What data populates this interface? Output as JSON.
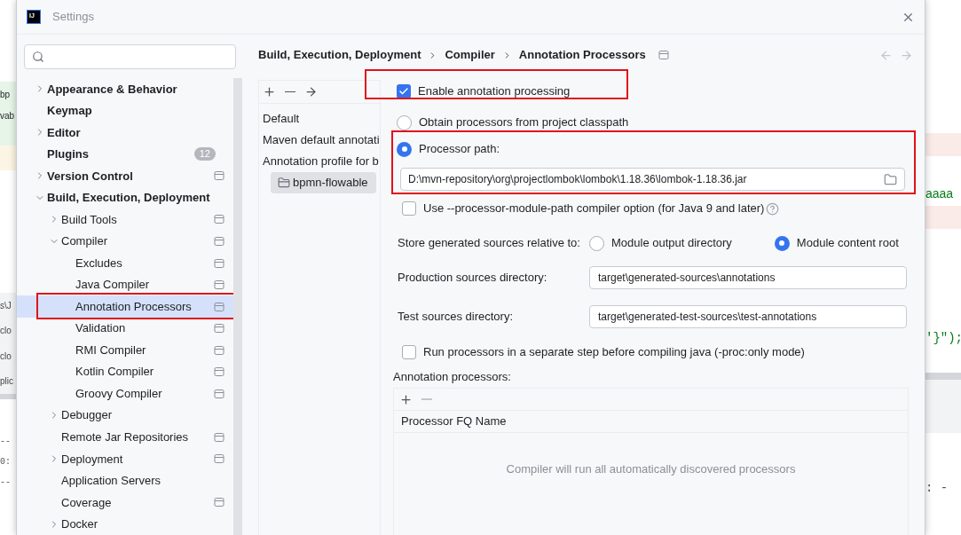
{
  "background": {
    "left_lines": [
      "bp",
      "vab",
      "s\\J",
      "clo",
      "clo",
      "plic",
      "--",
      "0:",
      "--"
    ],
    "right_lines": [
      "aaaa",
      "'}\");",
      ": -"
    ]
  },
  "window": {
    "logo": "IJ",
    "title": "Settings"
  },
  "sidebar": {
    "items": [
      {
        "label": "Appearance & Behavior",
        "expanded": false,
        "selected": false,
        "highlighted": false,
        "project_icon": false
      },
      {
        "label": "Keymap",
        "selected": false,
        "highlighted": false,
        "project_icon": false
      },
      {
        "label": "Editor",
        "expanded": false,
        "selected": false,
        "highlighted": false,
        "project_icon": false
      },
      {
        "label": "Plugins",
        "badge": "12",
        "selected": false,
        "highlighted": false,
        "project_icon": false
      },
      {
        "label": "Version Control",
        "expanded": false,
        "selected": false,
        "highlighted": false,
        "project_icon": true
      },
      {
        "label": "Build, Execution, Deployment",
        "expanded": true,
        "selected": false,
        "highlighted": false,
        "project_icon": false,
        "children": [
          {
            "label": "Build Tools",
            "expanded": false,
            "selected": false,
            "highlighted": false,
            "project_icon": true
          },
          {
            "label": "Compiler",
            "expanded": true,
            "selected": false,
            "highlighted": false,
            "project_icon": true,
            "children": [
              {
                "label": "Excludes",
                "selected": false,
                "highlighted": false,
                "project_icon": true
              },
              {
                "label": "Java Compiler",
                "selected": false,
                "highlighted": false,
                "project_icon": true
              },
              {
                "label": "Annotation Processors",
                "selected": true,
                "highlighted": true,
                "project_icon": true
              },
              {
                "label": "Validation",
                "selected": false,
                "highlighted": false,
                "project_icon": true
              },
              {
                "label": "RMI Compiler",
                "selected": false,
                "highlighted": false,
                "project_icon": true
              },
              {
                "label": "Kotlin Compiler",
                "selected": false,
                "highlighted": false,
                "project_icon": true
              },
              {
                "label": "Groovy Compiler",
                "selected": false,
                "highlighted": false,
                "project_icon": true
              }
            ]
          },
          {
            "label": "Debugger",
            "expanded": false,
            "selected": false,
            "highlighted": false,
            "project_icon": false
          },
          {
            "label": "Remote Jar Repositories",
            "selected": false,
            "highlighted": false,
            "project_icon": true
          },
          {
            "label": "Deployment",
            "expanded": false,
            "selected": false,
            "highlighted": false,
            "project_icon": true
          },
          {
            "label": "Application Servers",
            "selected": false,
            "highlighted": false,
            "project_icon": false
          },
          {
            "label": "Coverage",
            "selected": false,
            "highlighted": false,
            "project_icon": true
          },
          {
            "label": "Docker",
            "expanded": false,
            "selected": false,
            "highlighted": false,
            "project_icon": false
          }
        ]
      }
    ]
  },
  "breadcrumb": [
    "Build, Execution, Deployment",
    "Compiler",
    "Annotation Processors"
  ],
  "profiles": [
    {
      "label": "Default",
      "selected": false
    },
    {
      "label": "Maven default annotati",
      "selected": false
    },
    {
      "label": "Annotation profile for b",
      "selected": false,
      "children": [
        {
          "label": "bpmn-flowable",
          "selected": true
        }
      ]
    }
  ],
  "enable_processing": {
    "label": "Enable annotation processing",
    "checked": true,
    "highlighted": true
  },
  "processor_source": [
    {
      "label": "Obtain processors from project classpath",
      "selected": false
    },
    {
      "label": "Processor path:",
      "selected": true
    }
  ],
  "processor_path": {
    "value": "D:\\mvn-repository\\org\\projectlombok\\lombok\\1.18.36\\lombok-1.18.36.jar",
    "highlighted": true
  },
  "module_path_option": {
    "label": "Use --processor-module-path compiler option (for Java 9 and later)",
    "checked": false
  },
  "store_relative": {
    "label": "Store generated sources relative to:",
    "options": [
      {
        "label": "Module output directory",
        "selected": false
      },
      {
        "label": "Module content root",
        "selected": true
      }
    ]
  },
  "directories": [
    {
      "label": "Production sources directory:",
      "value": "target\\generated-sources\\annotations"
    },
    {
      "label": "Test sources directory:",
      "value": "target\\generated-test-sources\\test-annotations"
    }
  ],
  "separate_step": {
    "label": "Run processors in a separate step before compiling java (-proc:only mode)",
    "checked": false
  },
  "processors_table": {
    "title": "Annotation processors:",
    "columns": [
      "Processor FQ Name"
    ],
    "empty_text": "Compiler will run all automatically discovered processors"
  }
}
